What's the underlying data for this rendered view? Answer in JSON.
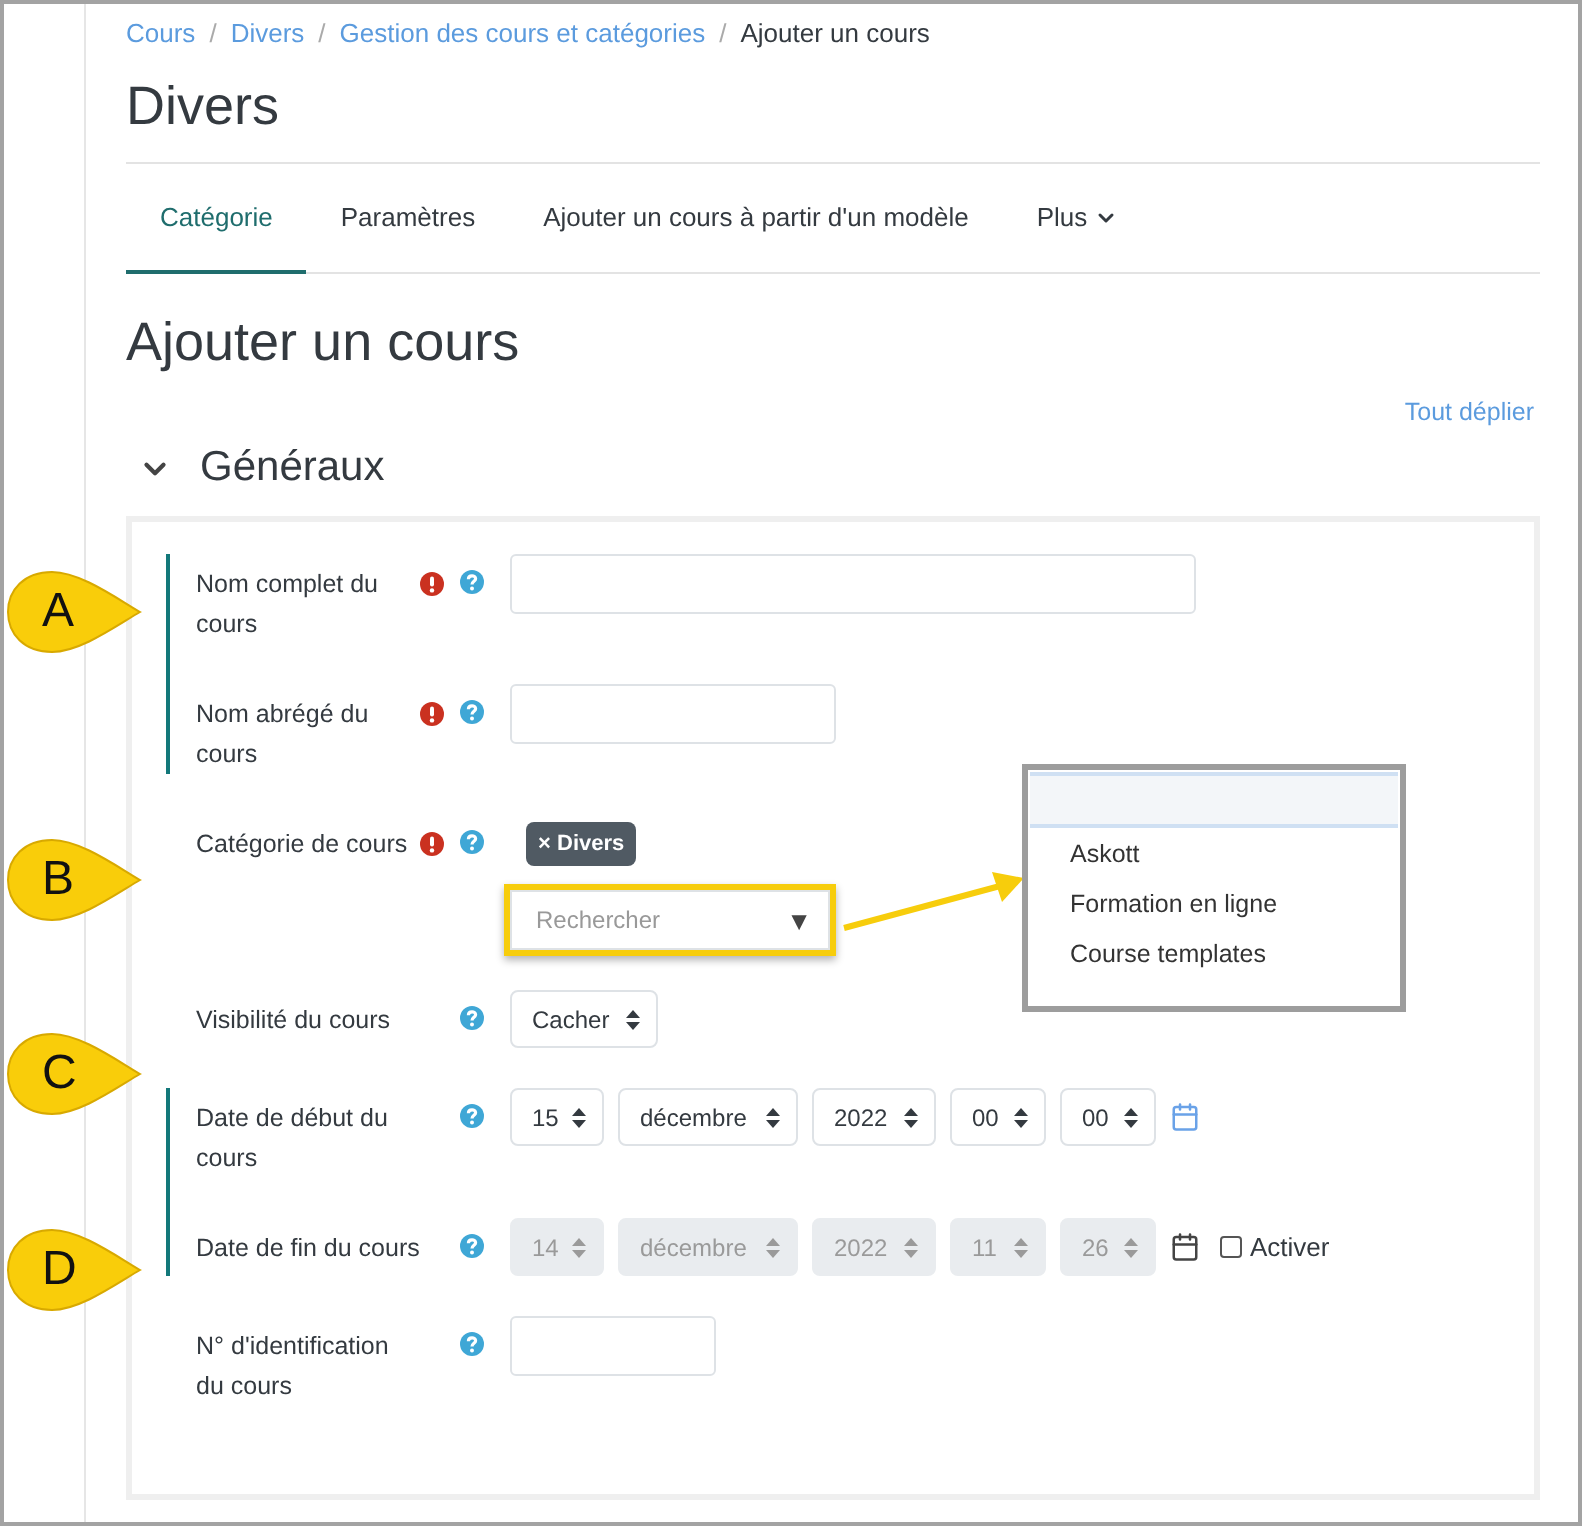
{
  "breadcrumb": {
    "separator": "/",
    "items": [
      {
        "label": "Cours",
        "link": true
      },
      {
        "label": "Divers",
        "link": true
      },
      {
        "label": "Gestion des cours et catégories",
        "link": true
      },
      {
        "label": "Ajouter un cours",
        "link": false
      }
    ]
  },
  "category_title": "Divers",
  "tabs": [
    {
      "label": "Catégorie",
      "selected": true,
      "kind": "tab"
    },
    {
      "label": "Paramètres",
      "selected": false,
      "kind": "tab"
    },
    {
      "label": "Ajouter un cours à partir d'un modèle",
      "selected": false,
      "kind": "tab"
    },
    {
      "label": "Plus",
      "selected": false,
      "kind": "menu"
    }
  ],
  "page_title": "Ajouter un cours",
  "expand_all": "Tout déplier",
  "section": {
    "title": "Généraux",
    "expanded": true,
    "fields": [
      {
        "kind": "text",
        "label": "Nom complet du cours",
        "required": true,
        "marked": true
      },
      {
        "kind": "text",
        "label": "Nom abrégé du cours",
        "required": true,
        "marked": true
      },
      {
        "kind": "autocomplete",
        "label": "Catégorie de cours",
        "required": true,
        "marked": false,
        "tags": [
          {
            "remove": "×",
            "label": "Divers"
          }
        ],
        "placeholder": "Rechercher",
        "toggle": "▼",
        "highlighted": true,
        "open": true,
        "options": [
          "Askott",
          "Formation en ligne",
          "Course templates"
        ]
      },
      {
        "kind": "select",
        "label": "Visibilité du cours",
        "required": false,
        "marked": false,
        "value": "Cacher"
      },
      {
        "kind": "date",
        "label": "Date de début du cours",
        "required": false,
        "marked": true,
        "disabled": false,
        "parts": [
          "15",
          "décembre",
          "2022",
          "00",
          "00"
        ]
      },
      {
        "kind": "date",
        "label": "Date de fin du cours",
        "required": false,
        "marked": true,
        "disabled": true,
        "parts": [
          "14",
          "décembre",
          "2022",
          "11",
          "26"
        ],
        "enable": {
          "label": "Activer",
          "checked": false
        }
      },
      {
        "kind": "text",
        "label": "N° d'identification du cours",
        "required": false,
        "marked": false
      }
    ]
  },
  "callouts": [
    {
      "letter": "A"
    },
    {
      "letter": "B"
    },
    {
      "letter": "C"
    },
    {
      "letter": "D"
    }
  ]
}
